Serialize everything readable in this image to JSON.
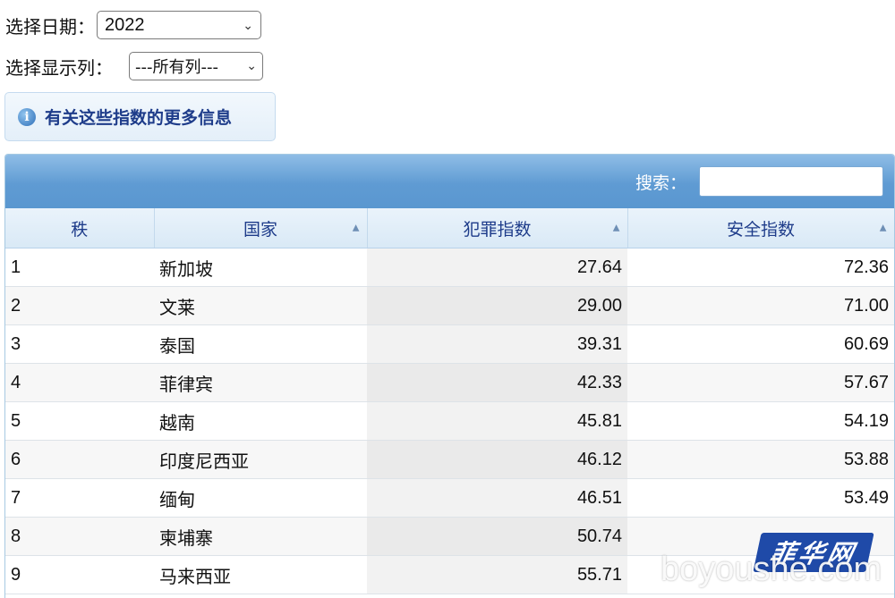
{
  "filters": {
    "date_label": "选择日期：",
    "date_value": "2022",
    "columns_label": "选择显示列：",
    "columns_value": "---所有列---"
  },
  "info_link": {
    "label": "有关这些指数的更多信息"
  },
  "search": {
    "label": "搜索：",
    "value": ""
  },
  "table": {
    "headers": [
      "秩",
      "国家",
      "犯罪指数",
      "安全指数"
    ],
    "rows": [
      {
        "rank": "1",
        "country": "新加坡",
        "crime": "27.64",
        "safety": "72.36"
      },
      {
        "rank": "2",
        "country": "文莱",
        "crime": "29.00",
        "safety": "71.00"
      },
      {
        "rank": "3",
        "country": "泰国",
        "crime": "39.31",
        "safety": "60.69"
      },
      {
        "rank": "4",
        "country": "菲律宾",
        "crime": "42.33",
        "safety": "57.67"
      },
      {
        "rank": "5",
        "country": "越南",
        "crime": "45.81",
        "safety": "54.19"
      },
      {
        "rank": "6",
        "country": "印度尼西亚",
        "crime": "46.12",
        "safety": "53.88"
      },
      {
        "rank": "7",
        "country": "缅甸",
        "crime": "46.51",
        "safety": "53.49"
      },
      {
        "rank": "8",
        "country": "柬埔寨",
        "crime": "50.74",
        "safety": ""
      },
      {
        "rank": "9",
        "country": "马来西亚",
        "crime": "55.71",
        "safety": ""
      }
    ]
  },
  "watermark": {
    "badge": "菲华网",
    "domain": "boyoushe.com"
  },
  "icons": {
    "info": "info-icon",
    "sort": "sort-ascending-icon",
    "dropdown": "chevron-down-icon"
  },
  "colors": {
    "header_bar": "#5f9bd3",
    "header_text": "#1e3c8a",
    "watermark_badge": "#1f4aa8"
  }
}
